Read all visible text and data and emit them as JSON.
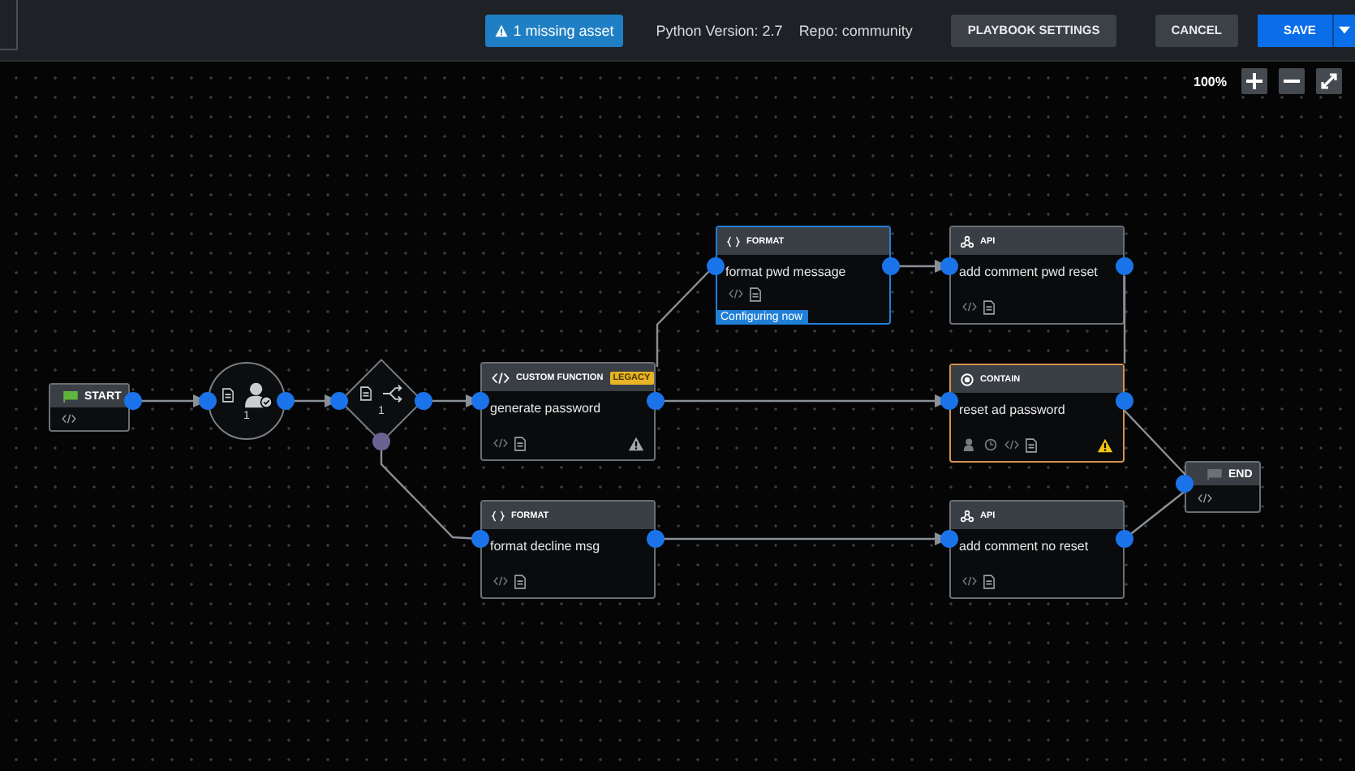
{
  "toolbar": {
    "missing_asset": "1 missing asset",
    "python_version": "Python Version: 2.7",
    "repo": "Repo: community",
    "buttons": [
      {
        "label": "PLAYBOOK SETTINGS",
        "kind": "secondary"
      },
      {
        "label": "CANCEL",
        "kind": "secondary"
      },
      {
        "label": "SAVE",
        "kind": "primary"
      }
    ]
  },
  "zoom": {
    "level_text": "100%"
  },
  "nodes": [
    {
      "kind": "start",
      "label": "START"
    },
    {
      "kind": "prompt",
      "count": "1"
    },
    {
      "kind": "decision",
      "count": "1"
    },
    {
      "kind": "custom_function",
      "type_label": "CUSTOM FUNCTION",
      "badge": "LEGACY",
      "title": "generate password",
      "alert": {
        "color": "#a3a8ad"
      },
      "selected": false,
      "flagged": false
    },
    {
      "kind": "format",
      "type_label": "FORMAT",
      "title": "format pwd message",
      "status": "Configuring now",
      "selected": true,
      "flagged": false
    },
    {
      "kind": "api",
      "type_label": "API",
      "title": "add comment pwd reset",
      "selected": false,
      "flagged": false
    },
    {
      "kind": "contain",
      "type_label": "CONTAIN",
      "title": "reset ad password",
      "alert": {
        "color": "#f2c511"
      },
      "selected": false,
      "flagged": true
    },
    {
      "kind": "format",
      "type_label": "FORMAT",
      "title": "format decline msg",
      "selected": false,
      "flagged": false
    },
    {
      "kind": "api",
      "type_label": "API",
      "title": "add comment no reset",
      "selected": false,
      "flagged": false
    },
    {
      "kind": "end",
      "label": "END"
    }
  ]
}
